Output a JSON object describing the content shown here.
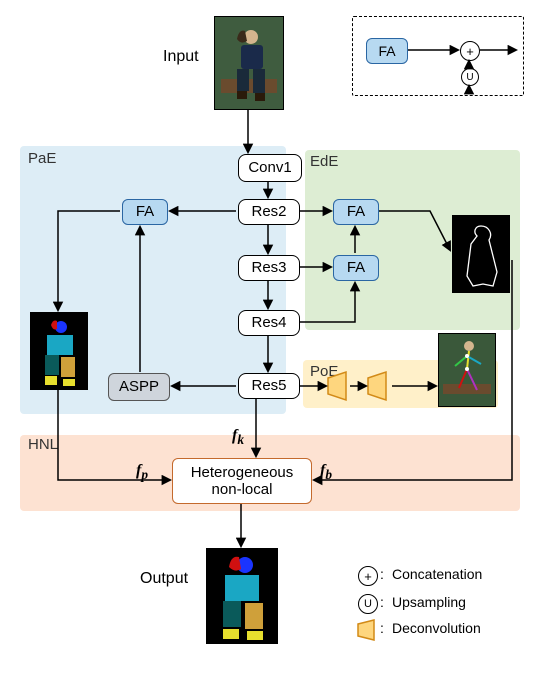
{
  "labels": {
    "input": "Input",
    "output": "Output",
    "conv1": "Conv1",
    "res2": "Res2",
    "res3": "Res3",
    "res4": "Res4",
    "res5": "Res5",
    "fa": "FA",
    "aspp": "ASPP",
    "hnl": "Heterogeneous\nnon-local",
    "pae": "PaE",
    "ede": "EdE",
    "poe": "PoE",
    "hnl_region": "HNL",
    "fk": "𝒇ₖ",
    "fp": "𝒇ₚ",
    "fb": "𝒇_b",
    "concat": "Concatenation",
    "upsample": "Upsampling",
    "deconv": "Deconvolution"
  },
  "colors": {
    "pae": "#ddedf6",
    "ede": "#ddedd3",
    "poe": "#fff0c9",
    "hnl": "#fde2d2",
    "fa_fill": "#b7d9f1",
    "fa_border": "#2a66a3",
    "aspp_fill": "#cfd5dc",
    "hnl_border": "#c46a2d",
    "deconv_fill": "#fed67e",
    "deconv_border": "#d28a17",
    "edge_outline": "#ffffff",
    "edge_bg": "#000000"
  },
  "chart_data": {
    "type": "diagram",
    "description": "Neural network architecture with backbone (Conv1, Res2-Res5), three encoder branches (PaE, EdE, PoE) producing features f_p, f_b, f_k that feed a Heterogeneous non-local (HNL) module, yielding the parsing output.",
    "backbone": [
      "Conv1",
      "Res2",
      "Res3",
      "Res4",
      "Res5"
    ],
    "branches": {
      "PaE": {
        "inputs": [
          "Res2",
          "Res5"
        ],
        "ops": [
          "ASPP",
          "FA"
        ],
        "output_feature": "f_p"
      },
      "EdE": {
        "inputs": [
          "Res2",
          "Res3",
          "Res4"
        ],
        "ops": [
          "FA",
          "FA"
        ],
        "output_feature": "f_b"
      },
      "PoE": {
        "inputs": [
          "Res5"
        ],
        "ops": [
          "Deconvolution",
          "Deconvolution"
        ],
        "output_feature": "f_k"
      }
    },
    "fusion": {
      "module": "Heterogeneous non-local",
      "inputs": [
        "f_p",
        "f_b",
        "f_k"
      ],
      "output": "Output"
    },
    "legend_inset": {
      "FA_module": "input → concat(with Upsampled(side_input)) → output"
    },
    "legend": {
      "⊕": "Concatenation",
      "Ⓤ": "Upsampling",
      "trapezoid": "Deconvolution"
    }
  }
}
